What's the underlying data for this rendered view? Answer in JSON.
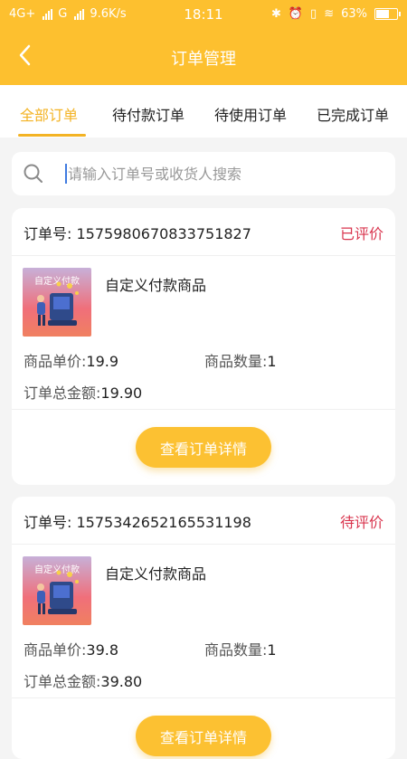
{
  "status_bar": {
    "network_left": "4G+",
    "network_right": "G",
    "speed": "9.6K/s",
    "time": "18:11",
    "battery": "63%"
  },
  "nav": {
    "title": "订单管理",
    "back_icon": "chevron-left-icon"
  },
  "tabs": [
    {
      "label": "全部订单",
      "active": true
    },
    {
      "label": "待付款订单",
      "active": false
    },
    {
      "label": "待使用订单",
      "active": false
    },
    {
      "label": "已完成订单",
      "active": false
    }
  ],
  "search": {
    "placeholder": "请输入订单号或收货人搜索"
  },
  "orders": [
    {
      "order_label": "订单号:",
      "order_no": "1575980670833751827",
      "status": "已评价",
      "thumb_caption": "自定义付款",
      "product_name": "自定义付款商品",
      "price_label": "商品单价:",
      "price": "19.9",
      "qty_label": "商品数量:",
      "qty": "1",
      "total_label": "订单总金额:",
      "total": "19.90",
      "button": "查看订单详情"
    },
    {
      "order_label": "订单号:",
      "order_no": "1575342652165531198",
      "status": "待评价",
      "thumb_caption": "自定义付款",
      "product_name": "自定义付款商品",
      "price_label": "商品单价:",
      "price": "39.8",
      "qty_label": "商品数量:",
      "qty": "1",
      "total_label": "订单总金额:",
      "total": "39.80",
      "button": "查看订单详情"
    }
  ],
  "colors": {
    "brand": "#fdc02f",
    "accent": "#f3b324",
    "status": "#d9354e"
  }
}
